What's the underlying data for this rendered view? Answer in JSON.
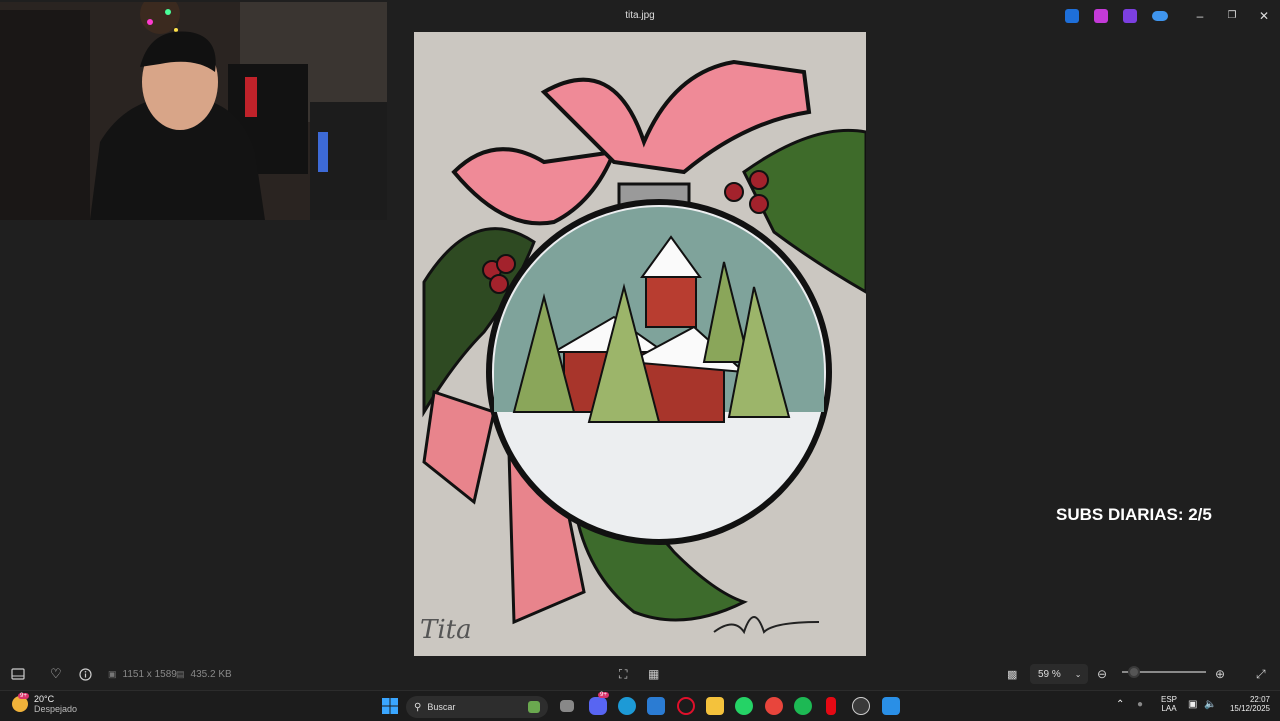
{
  "window": {
    "title": "tita.jpg"
  },
  "title_bar_apps": [
    {
      "name": "app-1",
      "color": "#3aa0ff"
    },
    {
      "name": "app-2",
      "color": "#d04ef5"
    },
    {
      "name": "app-3",
      "color": "#8b4fe0"
    },
    {
      "name": "onedrive",
      "color": "#4aa3f5"
    }
  ],
  "overlay": {
    "subs": "SUBS DIARIAS: 2/5"
  },
  "photo": {
    "signature": "Tita"
  },
  "toolbar": {
    "dimensions": "1151 x 1589",
    "filesize": "435.2 KB",
    "zoom": "59 %",
    "zoom_level": 0.08
  },
  "taskbar": {
    "weather_temp": "20°C",
    "weather_cond": "Despejado",
    "search_placeholder": "Buscar",
    "lang1": "ESP",
    "lang2": "LAA",
    "time": "22:07",
    "date": "15/12/2025",
    "badges": {
      "weather": "9+",
      "discord": "9+"
    }
  }
}
